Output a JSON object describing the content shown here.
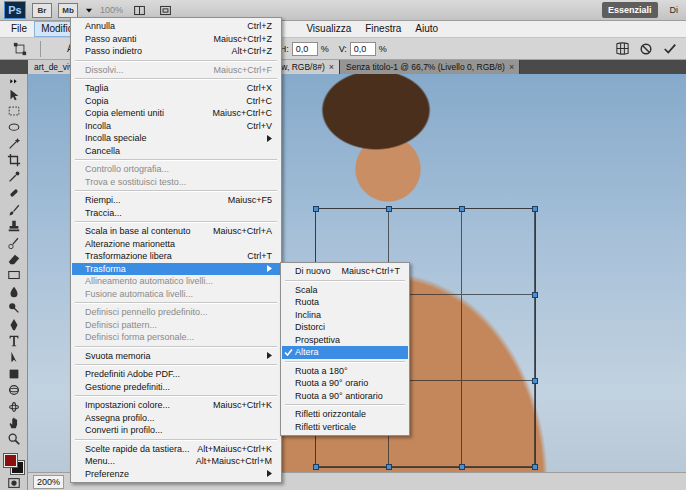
{
  "app_bar": {
    "logo": "Ps",
    "launchers": [
      "Br",
      "Mb"
    ],
    "zoom": "100%",
    "workspaces": [
      {
        "label": "Essenziali",
        "selected": true
      },
      {
        "label": "Di",
        "selected": false
      }
    ]
  },
  "menu_bar": {
    "items": [
      {
        "label": "File",
        "selected": false
      },
      {
        "label": "Modifica",
        "selected": true
      },
      {
        "label": "Visualizza",
        "selected": false
      },
      {
        "label": "Finestra",
        "selected": false
      },
      {
        "label": "Aiuto",
        "selected": false
      }
    ]
  },
  "options_bar": {
    "fragment": "A",
    "fields": [
      {
        "label": "H:",
        "value": "0,0",
        "unit": "%"
      },
      {
        "label": "V:",
        "value": "0,0",
        "unit": "%"
      }
    ]
  },
  "document_tabs": [
    {
      "label": "art_de_viv",
      "tail": "w, RGB/8#)",
      "close": "×",
      "selected": true
    },
    {
      "label": "Senza titolo-1 @ 66,7% (Livello 0, RGB/8)",
      "tail": "",
      "close": "×",
      "selected": false
    }
  ],
  "swatches": {
    "foreground": "#8b0f0f",
    "background": "#141414"
  },
  "status_bar": {
    "zoom": "200%"
  },
  "edit_menu": {
    "items": [
      {
        "kind": "item",
        "label": "Annulla",
        "shortcut": "Ctrl+Z",
        "submenu": false,
        "disabled": false,
        "selected": false
      },
      {
        "kind": "item",
        "label": "Passo avanti",
        "shortcut": "Maiusc+Ctrl+Z",
        "submenu": false,
        "disabled": false,
        "selected": false
      },
      {
        "kind": "item",
        "label": "Passo indietro",
        "shortcut": "Alt+Ctrl+Z",
        "submenu": false,
        "disabled": false,
        "selected": false
      },
      {
        "kind": "separator"
      },
      {
        "kind": "item",
        "label": "Dissolvi...",
        "shortcut": "Maiusc+Ctrl+F",
        "submenu": false,
        "disabled": true,
        "selected": false
      },
      {
        "kind": "separator"
      },
      {
        "kind": "item",
        "label": "Taglia",
        "shortcut": "Ctrl+X",
        "submenu": false,
        "disabled": false,
        "selected": false
      },
      {
        "kind": "item",
        "label": "Copia",
        "shortcut": "Ctrl+C",
        "submenu": false,
        "disabled": false,
        "selected": false
      },
      {
        "kind": "item",
        "label": "Copia elementi uniti",
        "shortcut": "Maiusc+Ctrl+C",
        "submenu": false,
        "disabled": false,
        "selected": false
      },
      {
        "kind": "item",
        "label": "Incolla",
        "shortcut": "Ctrl+V",
        "submenu": false,
        "disabled": false,
        "selected": false
      },
      {
        "kind": "item",
        "label": "Incolla speciale",
        "shortcut": "",
        "submenu": true,
        "disabled": false,
        "selected": false
      },
      {
        "kind": "item",
        "label": "Cancella",
        "shortcut": "",
        "submenu": false,
        "disabled": false,
        "selected": false
      },
      {
        "kind": "separator"
      },
      {
        "kind": "item",
        "label": "Controllo ortografia...",
        "shortcut": "",
        "submenu": false,
        "disabled": true,
        "selected": false
      },
      {
        "kind": "item",
        "label": "Trova e sostituisci testo...",
        "shortcut": "",
        "submenu": false,
        "disabled": true,
        "selected": false
      },
      {
        "kind": "separator"
      },
      {
        "kind": "item",
        "label": "Riempi...",
        "shortcut": "Maiusc+F5",
        "submenu": false,
        "disabled": false,
        "selected": false
      },
      {
        "kind": "item",
        "label": "Traccia...",
        "shortcut": "",
        "submenu": false,
        "disabled": false,
        "selected": false
      },
      {
        "kind": "separator"
      },
      {
        "kind": "item",
        "label": "Scala in base al contenuto",
        "shortcut": "Maiusc+Ctrl+A",
        "submenu": false,
        "disabled": false,
        "selected": false
      },
      {
        "kind": "item",
        "label": "Alterazione marionetta",
        "shortcut": "",
        "submenu": false,
        "disabled": false,
        "selected": false
      },
      {
        "kind": "item",
        "label": "Trasformazione libera",
        "shortcut": "Ctrl+T",
        "submenu": false,
        "disabled": false,
        "selected": false
      },
      {
        "kind": "item",
        "label": "Trasforma",
        "shortcut": "",
        "submenu": true,
        "disabled": false,
        "selected": true
      },
      {
        "kind": "item",
        "label": "Allineamento automatico livelli...",
        "shortcut": "",
        "submenu": false,
        "disabled": true,
        "selected": false
      },
      {
        "kind": "item",
        "label": "Fusione automatica livelli...",
        "shortcut": "",
        "submenu": false,
        "disabled": true,
        "selected": false
      },
      {
        "kind": "separator"
      },
      {
        "kind": "item",
        "label": "Definisci pennello predefinito...",
        "shortcut": "",
        "submenu": false,
        "disabled": true,
        "selected": false
      },
      {
        "kind": "item",
        "label": "Definisci pattern...",
        "shortcut": "",
        "submenu": false,
        "disabled": true,
        "selected": false
      },
      {
        "kind": "item",
        "label": "Definisci forma personale...",
        "shortcut": "",
        "submenu": false,
        "disabled": true,
        "selected": false
      },
      {
        "kind": "separator"
      },
      {
        "kind": "item",
        "label": "Svuota memoria",
        "shortcut": "",
        "submenu": true,
        "disabled": false,
        "selected": false
      },
      {
        "kind": "separator"
      },
      {
        "kind": "item",
        "label": "Predefiniti Adobe PDF...",
        "shortcut": "",
        "submenu": false,
        "disabled": false,
        "selected": false
      },
      {
        "kind": "item",
        "label": "Gestione predefiniti...",
        "shortcut": "",
        "submenu": false,
        "disabled": false,
        "selected": false
      },
      {
        "kind": "separator"
      },
      {
        "kind": "item",
        "label": "Impostazioni colore...",
        "shortcut": "Maiusc+Ctrl+K",
        "submenu": false,
        "disabled": false,
        "selected": false
      },
      {
        "kind": "item",
        "label": "Assegna profilo...",
        "shortcut": "",
        "submenu": false,
        "disabled": false,
        "selected": false
      },
      {
        "kind": "item",
        "label": "Converti in profilo...",
        "shortcut": "",
        "submenu": false,
        "disabled": false,
        "selected": false
      },
      {
        "kind": "separator"
      },
      {
        "kind": "item",
        "label": "Scelte rapide da tastiera...",
        "shortcut": "Alt+Maiusc+Ctrl+K",
        "submenu": false,
        "disabled": false,
        "selected": false
      },
      {
        "kind": "item",
        "label": "Menu...",
        "shortcut": "Alt+Maiusc+Ctrl+M",
        "submenu": false,
        "disabled": false,
        "selected": false
      },
      {
        "kind": "item",
        "label": "Preferenze",
        "shortcut": "",
        "submenu": true,
        "disabled": false,
        "selected": false
      }
    ]
  },
  "transform_submenu": {
    "items": [
      {
        "kind": "item",
        "label": "Di nuovo",
        "shortcut": "Maiusc+Ctrl+T",
        "checked": false,
        "selected": false
      },
      {
        "kind": "separator"
      },
      {
        "kind": "item",
        "label": "Scala",
        "shortcut": "",
        "checked": false,
        "selected": false
      },
      {
        "kind": "item",
        "label": "Ruota",
        "shortcut": "",
        "checked": false,
        "selected": false
      },
      {
        "kind": "item",
        "label": "Inclina",
        "shortcut": "",
        "checked": false,
        "selected": false
      },
      {
        "kind": "item",
        "label": "Distorci",
        "shortcut": "",
        "checked": false,
        "selected": false
      },
      {
        "kind": "item",
        "label": "Prospettiva",
        "shortcut": "",
        "checked": false,
        "selected": false
      },
      {
        "kind": "item",
        "label": "Altera",
        "shortcut": "",
        "checked": true,
        "selected": true
      },
      {
        "kind": "separator"
      },
      {
        "kind": "item",
        "label": "Ruota a 180°",
        "shortcut": "",
        "checked": false,
        "selected": false
      },
      {
        "kind": "item",
        "label": "Ruota a 90° orario",
        "shortcut": "",
        "checked": false,
        "selected": false
      },
      {
        "kind": "item",
        "label": "Ruota a 90° antiorario",
        "shortcut": "",
        "checked": false,
        "selected": false
      },
      {
        "kind": "separator"
      },
      {
        "kind": "item",
        "label": "Rifletti orizzontale",
        "shortcut": "",
        "checked": false,
        "selected": false
      },
      {
        "kind": "item",
        "label": "Rifletti verticale",
        "shortcut": "",
        "checked": false,
        "selected": false
      }
    ]
  }
}
